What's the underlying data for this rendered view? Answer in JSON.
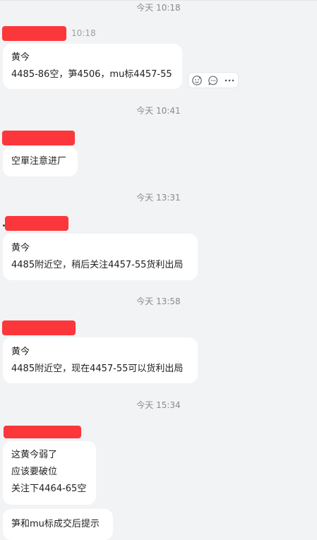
{
  "messages": [
    {
      "time": "今天 10:18",
      "sender_time": "10:18",
      "lines": [
        "黄今",
        "4485-86空，笋4506，mu标4457-55"
      ]
    },
    {
      "time": "今天 10:41",
      "lines": [
        "空單注意进厂"
      ]
    },
    {
      "time": "今天 13:31",
      "lines": [
        "黄今",
        "4485附近空，稍后关注4457-55货利出局"
      ]
    },
    {
      "time": "今天 13:58",
      "lines": [
        "黄今",
        "4485附近空，现在4457-55可以货利出局"
      ]
    },
    {
      "time": "今天 15:34",
      "lines": [
        "这黄今弱了",
        "应该要破位",
        "关注下4464-65空"
      ]
    },
    {
      "lines": [
        "笋和mu标成交后提示"
      ]
    }
  ],
  "actions": {
    "icons": [
      "reaction-icon",
      "comment-icon",
      "more-icon"
    ]
  },
  "colors": {
    "redaction": "#fc373b",
    "background": "#f2f3f5",
    "bubble": "#ffffff",
    "timestamp": "#8a8a8a"
  }
}
